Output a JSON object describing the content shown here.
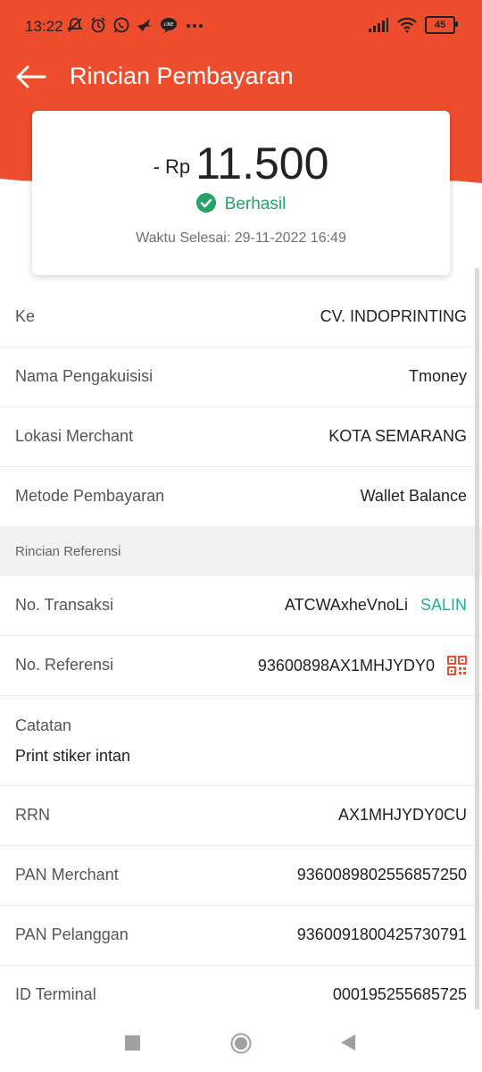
{
  "status_bar": {
    "time": "13:22",
    "battery": "45",
    "notification_icons": [
      "mute-icon",
      "alarm-icon",
      "whatsapp-icon",
      "bird-icon",
      "chat-icon",
      "more-icon"
    ]
  },
  "header": {
    "title": "Rincian Pembayaran",
    "accent_color": "#ee4d2d"
  },
  "summary": {
    "prefix": "- Rp",
    "amount": "11.500",
    "status": "Berhasil",
    "status_color": "#27a36a",
    "completed_at": "Waktu Selesai: 29-11-2022 16:49"
  },
  "details": {
    "to_label": "Ke",
    "to_value": "CV. INDOPRINTING",
    "acquirer_label": "Nama Pengakuisisi",
    "acquirer_value": "Tmoney",
    "location_label": "Lokasi Merchant",
    "location_value": "KOTA SEMARANG",
    "method_label": "Metode Pembayaran",
    "method_value": "Wallet Balance"
  },
  "reference": {
    "section_title": "Rincian Referensi",
    "trx_label": "No. Transaksi",
    "trx_value": "ATCWAxheVnoLi",
    "copy_label": "SALIN",
    "ref_label": "No. Referensi",
    "ref_value": "93600898AX1MHJYDY0",
    "note_label": "Catatan",
    "note_value": "Print stiker intan",
    "rrn_label": "RRN",
    "rrn_value": "AX1MHJYDY0CU",
    "pan_merchant_label": "PAN Merchant",
    "pan_merchant_value": "9360089802556857250",
    "pan_customer_label": "PAN Pelanggan",
    "pan_customer_value": "9360091800425730791",
    "terminal_label": "ID Terminal",
    "terminal_value": "000195255685725"
  }
}
